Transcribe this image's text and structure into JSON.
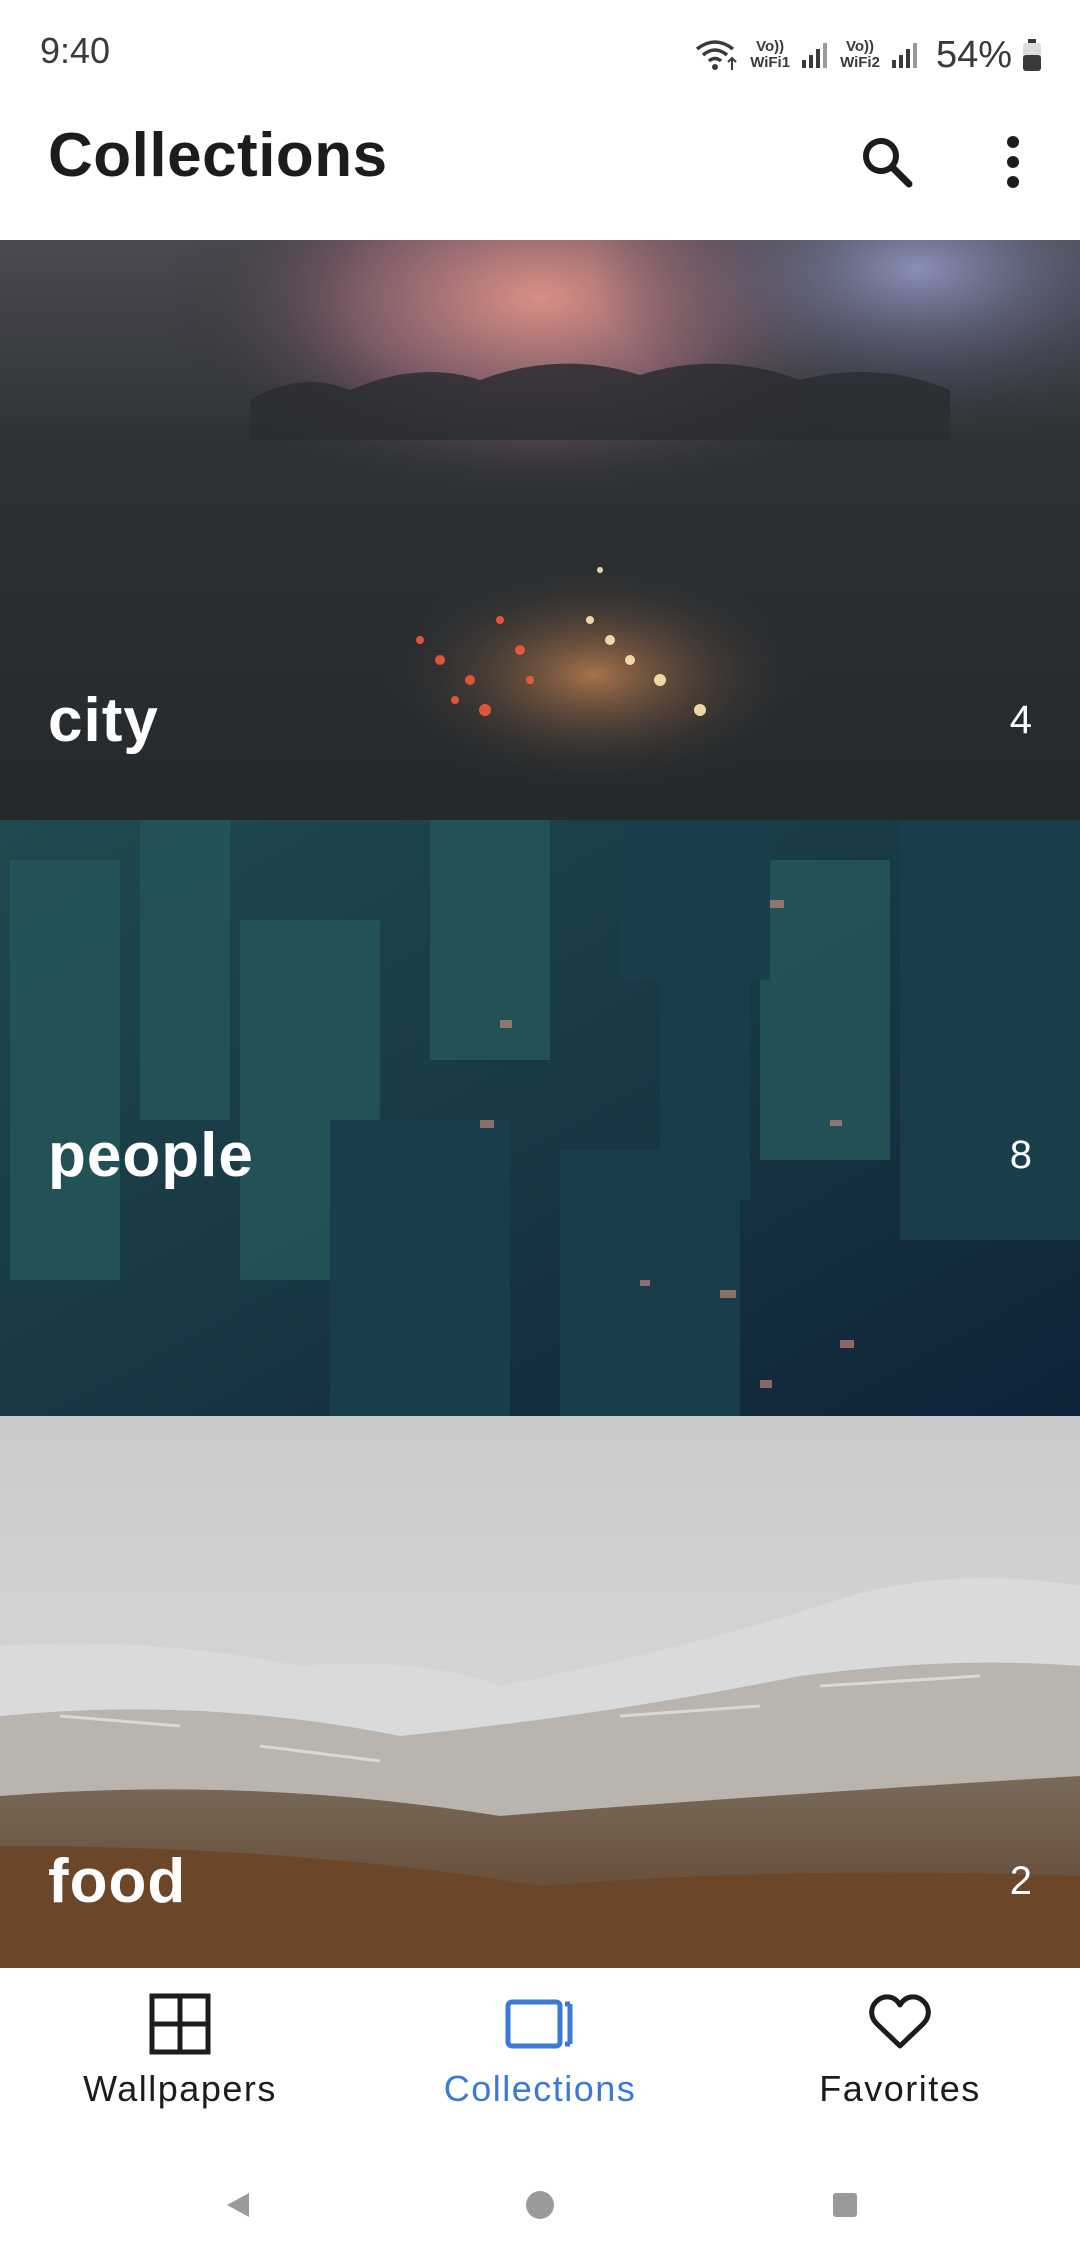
{
  "status_bar": {
    "time": "9:40",
    "wifi1_label_top": "Vo))",
    "wifi1_label_bottom": "WiFi1",
    "wifi2_label_top": "Vo))",
    "wifi2_label_bottom": "WiFi2",
    "battery": "54%",
    "icons": [
      "wifi-icon",
      "signal-icon",
      "battery-icon"
    ]
  },
  "app_bar": {
    "title": "Collections",
    "icons": [
      "search-icon",
      "more-vert-icon"
    ]
  },
  "collections": [
    {
      "name": "city",
      "count": "4"
    },
    {
      "name": "people",
      "count": "8"
    },
    {
      "name": "food",
      "count": "2"
    }
  ],
  "bottom_nav": {
    "items": [
      {
        "label": "Wallpapers",
        "icon": "grid-icon",
        "active": false
      },
      {
        "label": "Collections",
        "icon": "collections-icon",
        "active": true
      },
      {
        "label": "Favorites",
        "icon": "heart-icon",
        "active": false
      }
    ],
    "accent_color": "#3b78d8"
  },
  "system_nav": {
    "icons": [
      "back-icon",
      "home-icon",
      "recents-icon"
    ]
  }
}
